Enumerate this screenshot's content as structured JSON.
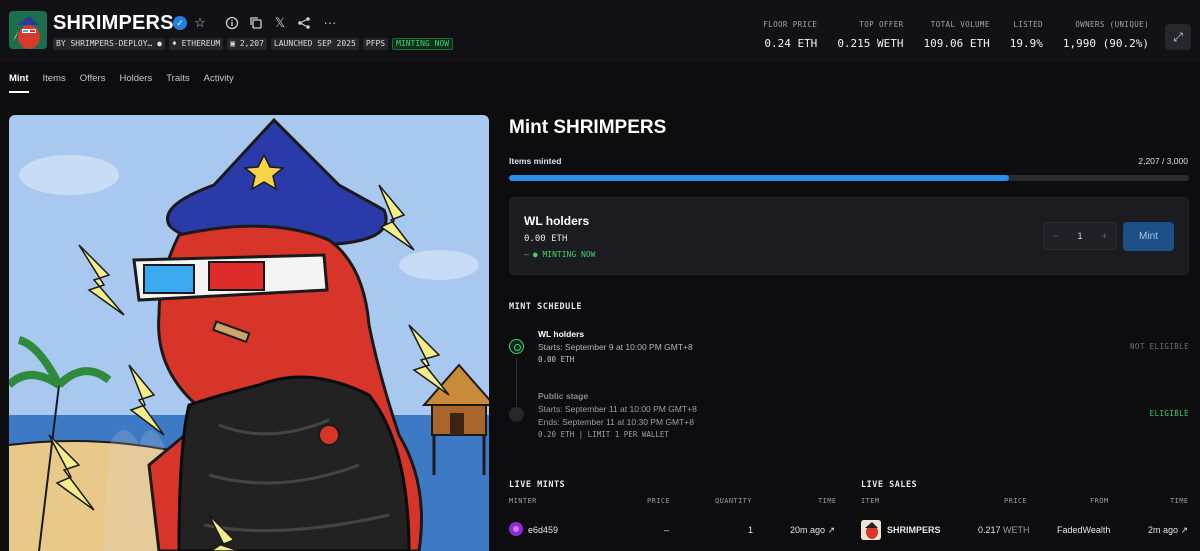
{
  "header": {
    "title": "SHRIMPERS",
    "badges": {
      "creator": "BY SHRIMPERS-DEPLOY…",
      "chain": "ETHEREUM",
      "items": "2,207",
      "launched": "LAUNCHED SEP 2025",
      "category": "PFPS",
      "status": "MINTING NOW"
    },
    "stats": [
      {
        "label": "FLOOR PRICE",
        "value": "0.24 ETH"
      },
      {
        "label": "TOP OFFER",
        "value": "0.215 WETH"
      },
      {
        "label": "TOTAL VOLUME",
        "value": "109.06 ETH"
      },
      {
        "label": "LISTED",
        "value": "19.9%"
      },
      {
        "label": "OWNERS (UNIQUE)",
        "value": "1,990 (90.2%)"
      }
    ]
  },
  "tabs": [
    "Mint",
    "Items",
    "Offers",
    "Holders",
    "Traits",
    "Activity"
  ],
  "mint": {
    "title": "Mint SHRIMPERS",
    "items_minted_label": "Items minted",
    "items_minted_value": "2,207 / 3,000",
    "progress_fraction": 0.7357,
    "wl_card": {
      "name": "WL holders",
      "price": "0.00",
      "currency": "ETH",
      "dash": "–",
      "status": "MINTING NOW",
      "quantity": "1",
      "minus": "−",
      "plus": "+",
      "button": "Mint"
    },
    "schedule_title": "MINT SCHEDULE",
    "stages": [
      {
        "name": "WL holders",
        "starts": "Starts: September 9 at 10:00 PM GMT+8",
        "price": "0.00",
        "currency": "ETH",
        "eligibility": "NOT ELIGIBLE"
      },
      {
        "name": "Public stage",
        "starts": "Starts: September 11 at 10:00 PM GMT+8",
        "ends": "Ends: September 11 at 10:30 PM GMT+8",
        "price": "0.20",
        "currency": "ETH | LIMIT 1 PER WALLET",
        "eligibility": "ELIGIBLE"
      }
    ]
  },
  "live_mints": {
    "title": "LIVE MINTS",
    "columns": [
      "MINTER",
      "PRICE",
      "QUANTITY",
      "TIME"
    ],
    "rows": [
      {
        "minter": "e6d459",
        "price": "–",
        "quantity": "1",
        "time": "20m ago ↗"
      }
    ]
  },
  "live_sales": {
    "title": "LIVE SALES",
    "columns": [
      "ITEM",
      "PRICE",
      "FROM",
      "TIME"
    ],
    "rows": [
      {
        "item": "SHRIMPERS",
        "price": "0.217",
        "currency": "WETH",
        "from": "FadedWealth",
        "time": "2m ago ↗"
      }
    ]
  },
  "colors": {
    "accent_blue": "#2790ea",
    "success_green": "#3ecf6e",
    "background": "#0d0d10"
  },
  "icons": [
    "verified-icon",
    "star-icon",
    "info-icon",
    "copy-icon",
    "x-icon",
    "share-icon",
    "more-icon",
    "expand-icon",
    "eth-icon",
    "items-icon"
  ]
}
